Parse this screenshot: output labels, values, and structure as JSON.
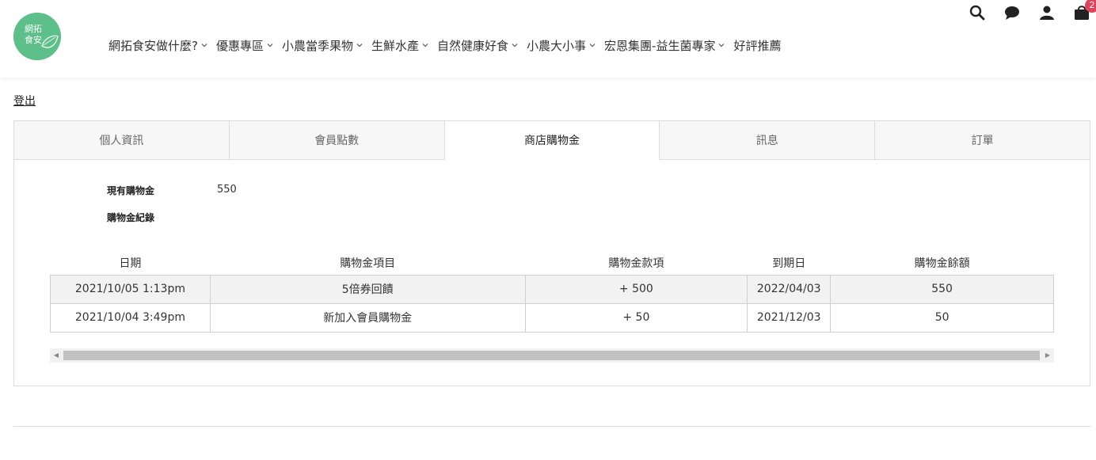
{
  "logo": {
    "text_line1": "網拓",
    "text_line2": "食安",
    "color": "#5dbf8a"
  },
  "nav": {
    "items": [
      {
        "label": "網拓食安做什麼?",
        "has_dropdown": true
      },
      {
        "label": "優惠專區",
        "has_dropdown": true
      },
      {
        "label": "小農當季果物",
        "has_dropdown": true
      },
      {
        "label": "生鮮水產",
        "has_dropdown": true
      },
      {
        "label": "自然健康好食",
        "has_dropdown": true
      },
      {
        "label": "小農大小事",
        "has_dropdown": true
      },
      {
        "label": "宏恩集團-益生菌專家",
        "has_dropdown": true
      },
      {
        "label": "好評推薦",
        "has_dropdown": false
      }
    ]
  },
  "header_icons": {
    "search": "search-icon",
    "chat": "chat-icon",
    "account": "user-icon",
    "cart": "cart-icon",
    "cart_badge": "2",
    "badge_color": "#e0445c"
  },
  "logout_label": "登出",
  "tabs": [
    {
      "label": "個人資訊",
      "active": false
    },
    {
      "label": "會員點數",
      "active": false
    },
    {
      "label": "商店購物金",
      "active": true
    },
    {
      "label": "訊息",
      "active": false
    },
    {
      "label": "訂單",
      "active": false
    }
  ],
  "credit": {
    "current_label": "現有購物金",
    "current_value": "550",
    "history_label": "購物金紀錄"
  },
  "table": {
    "headers": [
      "日期",
      "購物金項目",
      "購物金款項",
      "到期日",
      "購物金餘額"
    ],
    "rows": [
      [
        "2021/10/05 1:13pm",
        "5倍券回饋",
        "+ 500",
        "2022/04/03",
        "550"
      ],
      [
        "2021/10/04 3:49pm",
        "新加入會員購物金",
        "+ 50",
        "2021/12/03",
        "50"
      ]
    ]
  }
}
